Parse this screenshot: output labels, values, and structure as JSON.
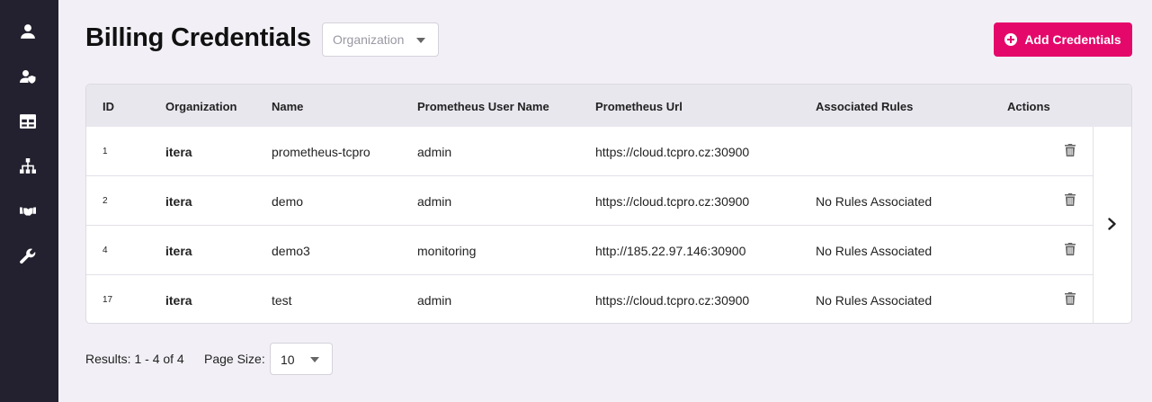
{
  "sidebar": {
    "items": [
      {
        "icon": "user-icon"
      },
      {
        "icon": "user-shield-icon"
      },
      {
        "icon": "table-icon"
      },
      {
        "icon": "sitemap-icon"
      },
      {
        "icon": "handshake-icon"
      },
      {
        "icon": "wrench-icon"
      }
    ]
  },
  "header": {
    "title": "Billing Credentials",
    "org_placeholder": "Organization",
    "add_button_label": "Add Credentials"
  },
  "table": {
    "columns": [
      "ID",
      "Organization",
      "Name",
      "Prometheus User Name",
      "Prometheus Url",
      "Associated Rules",
      "Actions"
    ],
    "rows": [
      {
        "id": "1",
        "org": "itera",
        "name": "prometheus-tcpro",
        "user": "admin",
        "url": "https://cloud.tcpro.cz:30900",
        "rules": ""
      },
      {
        "id": "2",
        "org": "itera",
        "name": "demo",
        "user": "admin",
        "url": "https://cloud.tcpro.cz:30900",
        "rules": "No Rules Associated"
      },
      {
        "id": "4",
        "org": "itera",
        "name": "demo3",
        "user": "monitoring",
        "url": "http://185.22.97.146:30900",
        "rules": "No Rules Associated"
      },
      {
        "id": "17",
        "org": "itera",
        "name": "test",
        "user": "admin",
        "url": "https://cloud.tcpro.cz:30900",
        "rules": "No Rules Associated"
      }
    ]
  },
  "footer": {
    "results": "Results: 1 - 4 of 4",
    "page_size_label": "Page Size:",
    "page_size_value": "10"
  },
  "colors": {
    "accent": "#e5086b",
    "sidebar_bg": "#23212f",
    "page_bg": "#f2f0f6"
  }
}
